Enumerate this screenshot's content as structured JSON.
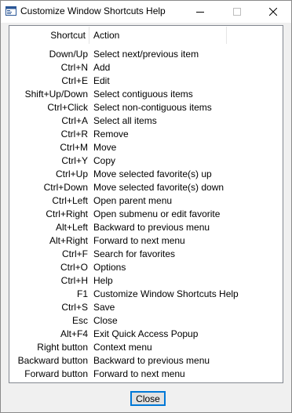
{
  "window": {
    "title": "Customize Window Shortcuts Help"
  },
  "titlebar_buttons": {
    "minimize_icon": "minimize-icon",
    "maximize_icon": "maximize-icon",
    "close_icon": "close-icon"
  },
  "table": {
    "headers": {
      "shortcut": "Shortcut",
      "action": "Action"
    },
    "rows": [
      {
        "shortcut": "Down/Up",
        "action": "Select next/previous item"
      },
      {
        "shortcut": "Ctrl+N",
        "action": "Add"
      },
      {
        "shortcut": "Ctrl+E",
        "action": "Edit"
      },
      {
        "shortcut": "Shift+Up/Down",
        "action": "Select contiguous items"
      },
      {
        "shortcut": "Ctrl+Click",
        "action": "Select non-contiguous items"
      },
      {
        "shortcut": "Ctrl+A",
        "action": "Select all items"
      },
      {
        "shortcut": "Ctrl+R",
        "action": "Remove"
      },
      {
        "shortcut": "Ctrl+M",
        "action": "Move"
      },
      {
        "shortcut": "Ctrl+Y",
        "action": "Copy"
      },
      {
        "shortcut": "Ctrl+Up",
        "action": "Move selected favorite(s) up"
      },
      {
        "shortcut": "Ctrl+Down",
        "action": "Move selected favorite(s) down"
      },
      {
        "shortcut": "Ctrl+Left",
        "action": "Open parent menu"
      },
      {
        "shortcut": "Ctrl+Right",
        "action": "Open submenu or edit favorite"
      },
      {
        "shortcut": "Alt+Left",
        "action": "Backward to previous menu"
      },
      {
        "shortcut": "Alt+Right",
        "action": "Forward to next menu"
      },
      {
        "shortcut": "Ctrl+F",
        "action": "Search for favorites"
      },
      {
        "shortcut": "Ctrl+O",
        "action": "Options"
      },
      {
        "shortcut": "Ctrl+H",
        "action": "Help"
      },
      {
        "shortcut": "F1",
        "action": "Customize Window Shortcuts Help"
      },
      {
        "shortcut": "Ctrl+S",
        "action": "Save"
      },
      {
        "shortcut": "Esc",
        "action": "Close"
      },
      {
        "shortcut": "Alt+F4",
        "action": "Exit Quick Access Popup"
      },
      {
        "shortcut": "Right button",
        "action": "Context menu"
      },
      {
        "shortcut": "Backward button",
        "action": "Backward to previous menu"
      },
      {
        "shortcut": "Forward button",
        "action": "Forward to next menu"
      }
    ]
  },
  "buttons": {
    "close_label": "Close"
  },
  "colors": {
    "window_bg": "#f0f0f0",
    "titlebar_bg": "#ffffff",
    "list_border": "#828790",
    "button_focus": "#0078d7"
  }
}
